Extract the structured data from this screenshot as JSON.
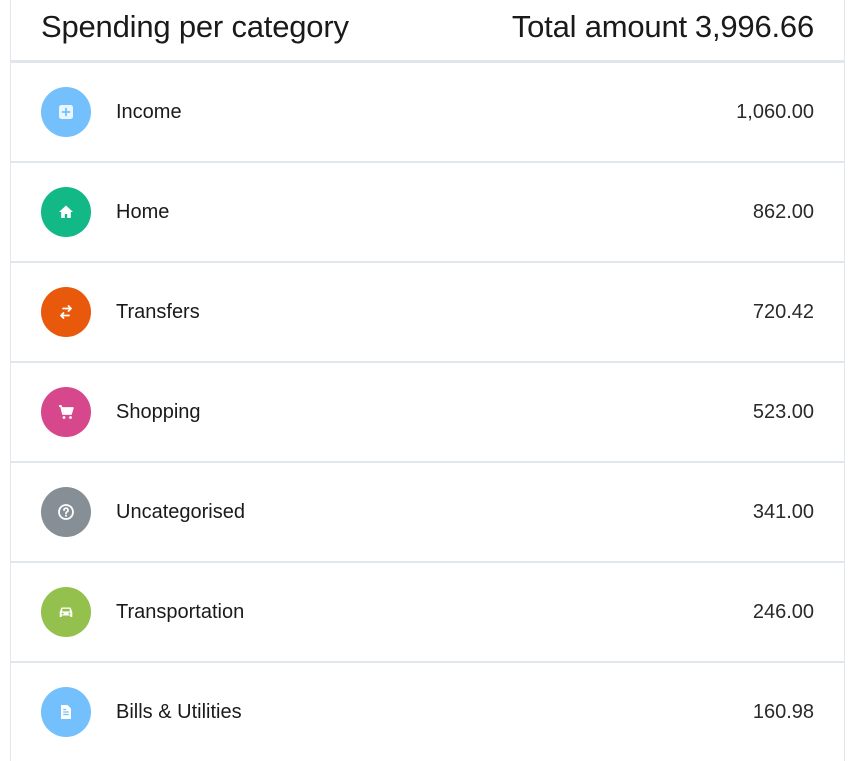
{
  "header": {
    "title": "Spending per category",
    "total_label": "Total amount",
    "total_value": "3,996.66"
  },
  "categories": [
    {
      "label": "Income",
      "amount": "1,060.00",
      "icon": "plus-square-icon",
      "color": "#74c0fc"
    },
    {
      "label": "Home",
      "amount": "862.00",
      "icon": "home-icon",
      "color": "#12b886"
    },
    {
      "label": "Transfers",
      "amount": "720.42",
      "icon": "swap-arrows-icon",
      "color": "#e8590c"
    },
    {
      "label": "Shopping",
      "amount": "523.00",
      "icon": "shopping-cart-icon",
      "color": "#d6478b"
    },
    {
      "label": "Uncategorised",
      "amount": "341.00",
      "icon": "question-circle-icon",
      "color": "#868e96"
    },
    {
      "label": "Transportation",
      "amount": "246.00",
      "icon": "car-icon",
      "color": "#94c14e"
    },
    {
      "label": "Bills & Utilities",
      "amount": "160.98",
      "icon": "document-icon",
      "color": "#74c0fc"
    }
  ]
}
